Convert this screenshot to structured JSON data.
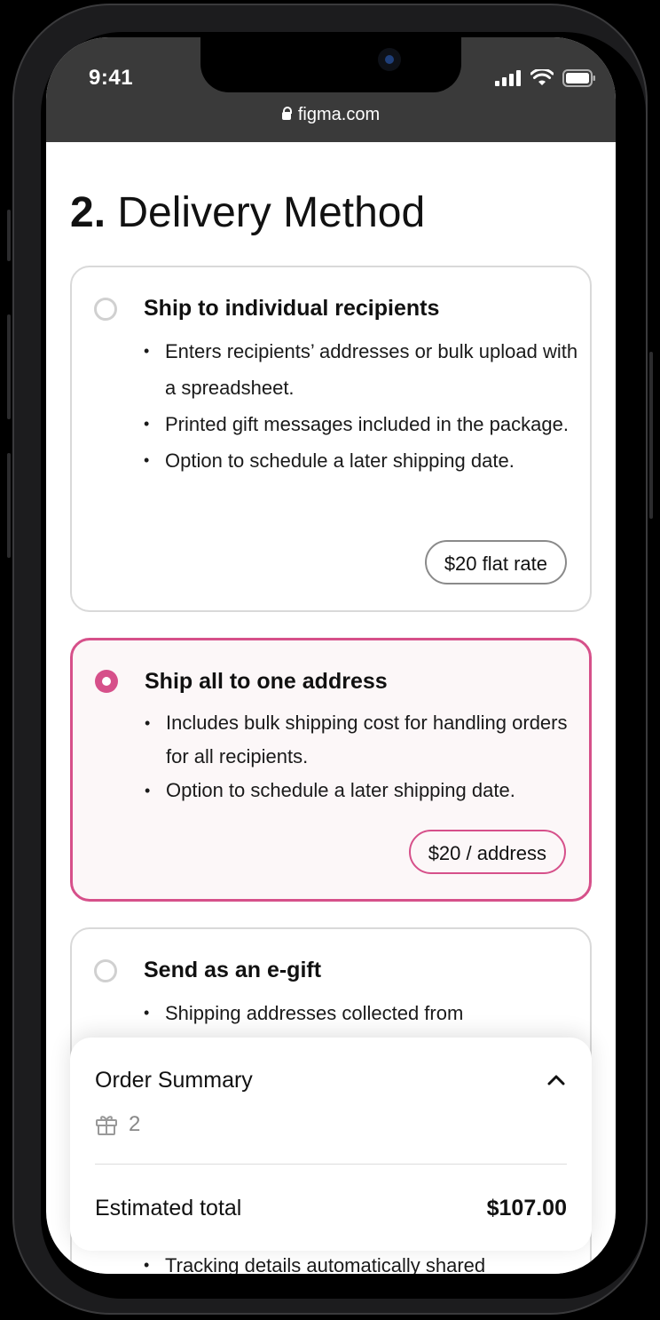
{
  "status_bar": {
    "time": "9:41",
    "url": "figma.com"
  },
  "page": {
    "title_number": "2.",
    "title_text": "Delivery Method"
  },
  "options": [
    {
      "title": "Ship to individual recipients",
      "selected": false,
      "bullets": [
        "Enters recipients’ addresses or bulk upload with a spreadsheet.",
        "Printed gift messages included in the package.",
        "Option to schedule a later shipping date."
      ],
      "price": "$20 flat rate"
    },
    {
      "title": "Ship all to one address",
      "selected": true,
      "bullets": [
        "Includes bulk shipping cost for handling orders for all recipients.",
        "Option to schedule a later shipping date."
      ],
      "price": "$20 / address"
    },
    {
      "title": "Send as an e-gift",
      "selected": false,
      "bullets": [
        "Shipping addresses collected from",
        "Tracking details automatically shared"
      ]
    }
  ],
  "order_summary": {
    "title": "Order Summary",
    "gift_count": "2",
    "estimated_total_label": "Estimated total",
    "estimated_total_value": "$107.00"
  },
  "colors": {
    "accent": "#d6508a",
    "selected_bg": "#fcf7f8",
    "statusbar_bg": "#3a3a3a"
  }
}
